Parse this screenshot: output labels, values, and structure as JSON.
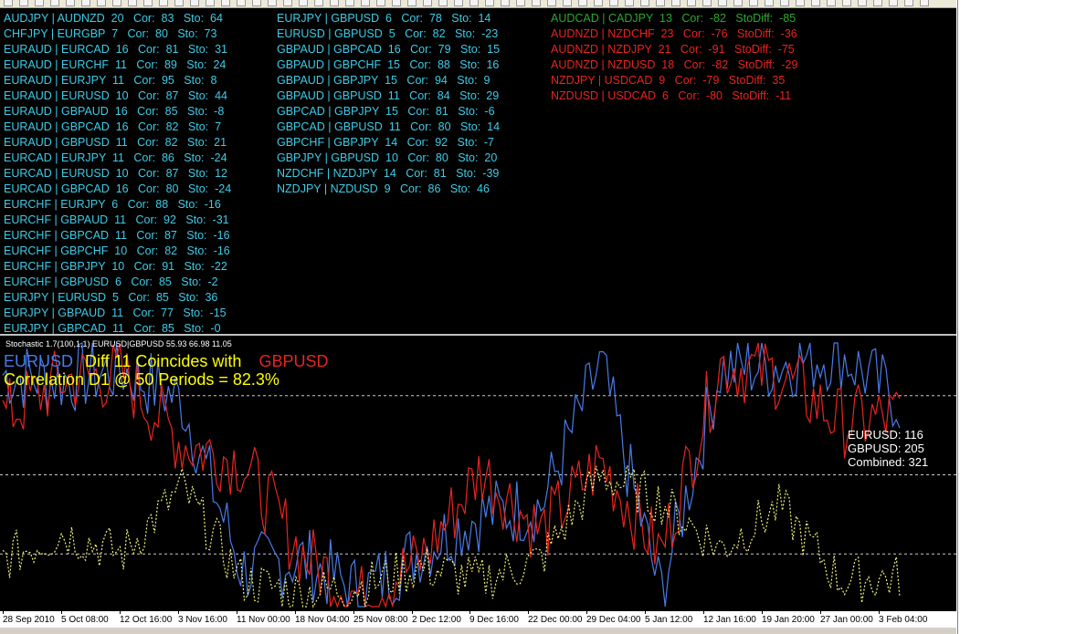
{
  "top_pane": {
    "col1": [
      "AUDJPY | AUDNZD  20   Cor:  83   Sto:  64",
      "CHFJPY | EURGBP  7   Cor:  80   Sto:  73",
      "EURAUD | EURCAD  16   Cor:  81   Sto:  31",
      "EURAUD | EURCHF  11   Cor:  89   Sto:  24",
      "EURAUD | EURJPY  11   Cor:  95   Sto:  8",
      "EURAUD | EURUSD  10   Cor:  87   Sto:  44",
      "EURAUD | GBPAUD  16   Cor:  85   Sto:  -8",
      "EURAUD | GBPCAD  16   Cor:  82   Sto:  7",
      "EURAUD | GBPUSD  11   Cor:  82   Sto:  21",
      "EURCAD | EURJPY  11   Cor:  86   Sto:  -24",
      "EURCAD | EURUSD  10   Cor:  87   Sto:  12",
      "EURCAD | GBPCAD  16   Cor:  80   Sto:  -24",
      "EURCHF | EURJPY  6   Cor:  88   Sto:  -16",
      "EURCHF | GBPAUD  11   Cor:  92   Sto:  -31",
      "EURCHF | GBPCAD  11   Cor:  87   Sto:  -16",
      "EURCHF | GBPCHF  10   Cor:  82   Sto:  -16",
      "EURCHF | GBPJPY  10   Cor:  91   Sto:  -22",
      "EURCHF | GBPUSD  6   Cor:  85   Sto:  -2",
      "EURJPY | EURUSD  5   Cor:  85   Sto:  36",
      "EURJPY | GBPAUD  11   Cor:  77   Sto:  -15",
      "EURJPY | GBPCAD  11   Cor:  85   Sto:  -0"
    ],
    "col2": [
      "EURJPY | GBPUSD  6   Cor:  78   Sto:  14",
      "EURUSD | GBPUSD  5   Cor:  82   Sto:  -23",
      "GBPAUD | GBPCAD  16   Cor:  79   Sto:  15",
      "GBPAUD | GBPCHF  15   Cor:  88   Sto:  16",
      "GBPAUD | GBPJPY  15   Cor:  94   Sto:  9",
      "GBPAUD | GBPUSD  11   Cor:  84   Sto:  29",
      "GBPCAD | GBPJPY  15   Cor:  81   Sto:  -6",
      "GBPCAD | GBPUSD  11   Cor:  80   Sto:  14",
      "GBPCHF | GBPJPY  14   Cor:  92   Sto:  -7",
      "GBPJPY | GBPUSD  10   Cor:  80   Sto:  20",
      "NZDCHF | NZDJPY  14   Cor:  81   Sto:  -39",
      "NZDJPY | NZDUSD  9   Cor:  86   Sto:  46"
    ],
    "col3": [
      {
        "text": "AUDCAD | CADJPY  13   Cor:  -82   StoDiff:  -85",
        "color": "#2fa82f"
      },
      {
        "text": "AUDNZD | NZDCHF  23   Cor:  -76   StoDiff:  -36",
        "color": "#e8241e"
      },
      {
        "text": "AUDNZD | NZDJPY  21   Cor:  -91   StoDiff:  -75",
        "color": "#e8241e"
      },
      {
        "text": "AUDNZD | NZDUSD  18   Cor:  -82   StoDiff:  -29",
        "color": "#e8241e"
      },
      {
        "text": "NZDJPY | USDCAD  9   Cor:  -79   StoDiff:  35",
        "color": "#e8241e"
      },
      {
        "text": "NZDUSD | USDCAD  6   Cor:  -80   StoDiff:  -11",
        "color": "#e8241e"
      }
    ]
  },
  "indicator": {
    "title": "Stochastic 1.7(100,1,1) EURUSD|GBPUSD 55.93 66.98 11.05",
    "sym1": "EURUSD",
    "diff_text": "Diff 11 Coincides with",
    "sym2": "GBPUSD",
    "correlation": "Correlation D1 @ 50 Periods = 82.3%",
    "readout": [
      "EURUSD: 116",
      "GBPUSD: 205",
      "Combined: 321"
    ]
  },
  "x_axis": [
    "28 Sep 2010",
    "5 Oct 08:00",
    "12 Oct 16:00",
    "3 Nov 16:00",
    "11 Nov 00:00",
    "18 Nov 04:00",
    "25 Nov 08:00",
    "2 Dec 12:00",
    "9 Dec 16:00",
    "22 Dec 00:00",
    "29 Dec 04:00",
    "5 Jan 12:00",
    "12 Jan 16:00",
    "19 Jan 20:00",
    "27 Jan 00:00",
    "3 Feb 04:00"
  ],
  "colors": {
    "eurusd": "#4a7be8",
    "gbpusd": "#e8241e",
    "diff": "#f2f27a",
    "pairs": "#3ecbe6",
    "grid": "#ffffff"
  },
  "chart_data": {
    "type": "line",
    "ylim": [
      0,
      100
    ],
    "levels": [
      80,
      50,
      20
    ],
    "x": [
      "28 Sep 2010",
      "5 Oct 08:00",
      "12 Oct 16:00",
      "3 Nov 16:00",
      "11 Nov 00:00",
      "18 Nov 04:00",
      "25 Nov 08:00",
      "2 Dec 12:00",
      "9 Dec 16:00",
      "22 Dec 00:00",
      "29 Dec 04:00",
      "5 Jan 12:00",
      "12 Jan 16:00",
      "19 Jan 20:00",
      "27 Jan 00:00",
      "3 Feb 04:00"
    ],
    "series": [
      {
        "name": "EURUSD",
        "color": "#4a7be8",
        "values": [
          88,
          86,
          90,
          78,
          14,
          18,
          5,
          22,
          35,
          38,
          92,
          5,
          90,
          92,
          96,
          78
        ]
      },
      {
        "name": "GBPUSD",
        "color": "#e8241e",
        "values": [
          72,
          86,
          88,
          62,
          55,
          20,
          3,
          18,
          52,
          28,
          55,
          20,
          92,
          88,
          70,
          72
        ]
      },
      {
        "name": "Diff",
        "color": "#f2f27a",
        "values": [
          18,
          28,
          20,
          45,
          10,
          5,
          8,
          15,
          10,
          18,
          50,
          40,
          22,
          38,
          10,
          11
        ]
      }
    ]
  }
}
